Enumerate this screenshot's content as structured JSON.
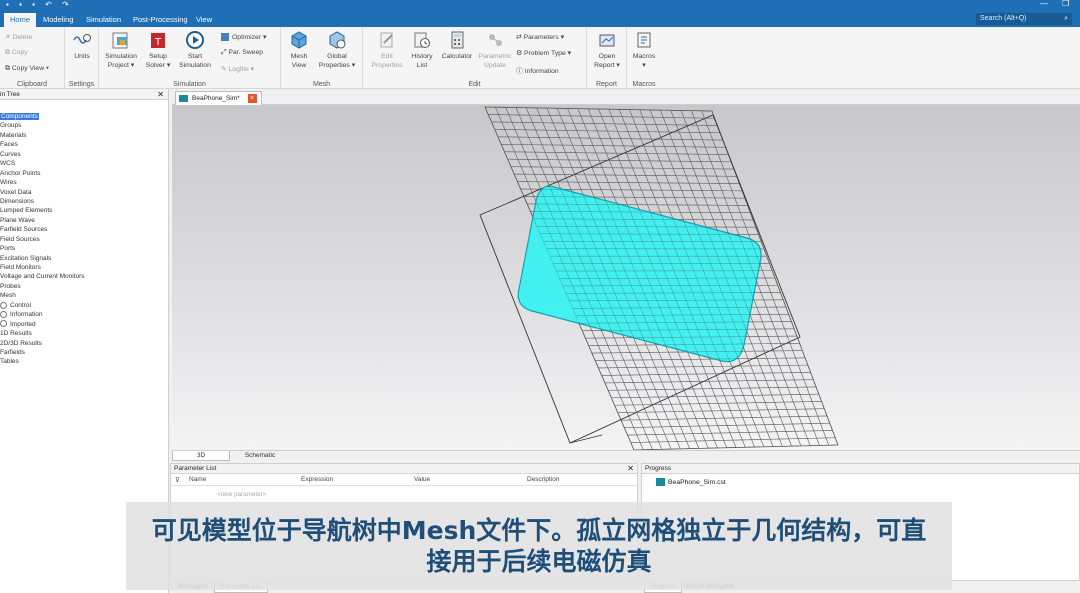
{
  "colors": {
    "accent": "#1e6fb6",
    "selection": "#3a7bd5",
    "mesh_body": "#2ef2f2",
    "subtitle_text": "#1f4e79"
  },
  "ribbon_tabs": [
    "Home",
    "Modeling",
    "Simulation",
    "Post-Processing",
    "View"
  ],
  "search": {
    "placeholder": "Search (Alt+Q)"
  },
  "clipboard": {
    "delete": "Delete",
    "copy": "Copy",
    "copy_view": "Copy View",
    "label": "Clipboard"
  },
  "settings": {
    "units": "Units",
    "label": "Settings"
  },
  "simulation": {
    "project_l1": "Simulation",
    "project_l2": "Project",
    "setup_l1": "Setup",
    "setup_l2": "Solver",
    "start_l1": "Start",
    "start_l2": "Simulation",
    "optimizer": "Optimizer",
    "par_sweep": "Par. Sweep",
    "logfile": "Logfile",
    "label": "Simulation"
  },
  "mesh": {
    "view_l1": "Mesh",
    "view_l2": "View",
    "global_l1": "Global",
    "global_l2": "Properties",
    "label": "Mesh"
  },
  "edit": {
    "edit_l1": "Edit",
    "edit_l2": "Properties",
    "history_l1": "History",
    "history_l2": "List",
    "calculator": "Calculator",
    "param_l1": "Parametric",
    "param_l2": "Update",
    "parameters": "Parameters",
    "problem_type": "Problem Type",
    "information": "Information",
    "label": "Edit"
  },
  "report": {
    "open_l1": "Open",
    "open_l2": "Report",
    "label": "Report"
  },
  "macros": {
    "macros": "Macros",
    "label": "Macros"
  },
  "tree": {
    "title": "in Tree",
    "items": [
      "Components",
      "Groups",
      "Materials",
      "Faces",
      "Curves",
      "WCS",
      "Anchor Points",
      "Wires",
      "Voxel Data",
      "Dimensions",
      "Lumped Elements",
      "Plane Wave",
      "Farfield Sources",
      "Field Sources",
      "Ports",
      "Excitation Signals",
      "Field Monitors",
      "Voltage and Current Monitors",
      "Probes",
      "Mesh"
    ],
    "mesh_children": [
      "Control",
      "Information",
      "Imported"
    ],
    "items_after": [
      "1D Results",
      "2D/3D Results",
      "Farfields",
      "Tables"
    ]
  },
  "document_tab": "BeaPhone_Sim*",
  "view_tabs": [
    "3D",
    "Schematic"
  ],
  "parameter_list": {
    "title": "Parameter List",
    "columns": [
      "Name",
      "Expression",
      "Value",
      "Description"
    ],
    "new_param": "<new parameter>"
  },
  "progress": {
    "title": "Progress",
    "item": "BeaPhone_Sim.cst"
  },
  "bottom_tabs_left": [
    "Messages",
    "Parameter List"
  ],
  "bottom_tabs_right": [
    "Progress",
    "Result Navigator"
  ],
  "subtitle": {
    "line1": "可见模型位于导航树中Mesh文件下。孤立网格独立于几何结构，可直",
    "line2": "接用于后续电磁仿真"
  }
}
